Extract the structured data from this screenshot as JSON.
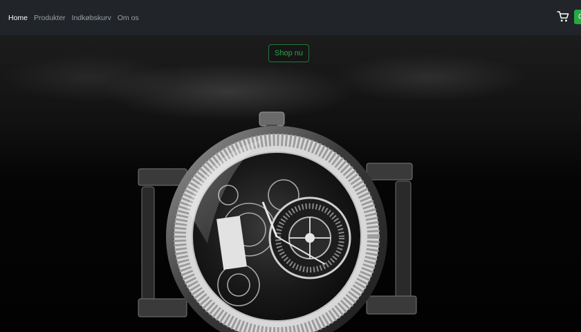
{
  "nav": {
    "links": [
      {
        "label": "Home",
        "active": true
      },
      {
        "label": "Produkter",
        "active": false
      },
      {
        "label": "Indkøbskurv",
        "active": false
      },
      {
        "label": "Om os",
        "active": false
      }
    ],
    "cart_icon": "shopping-cart-icon",
    "right_button_label": "C"
  },
  "hero": {
    "cta_label": "Shop nu",
    "image": "wristwatch-photo"
  },
  "colors": {
    "navbar_bg": "#212529",
    "accent_green": "#28a745",
    "nav_text": "#9aa0a6",
    "nav_text_active": "#ffffff"
  }
}
